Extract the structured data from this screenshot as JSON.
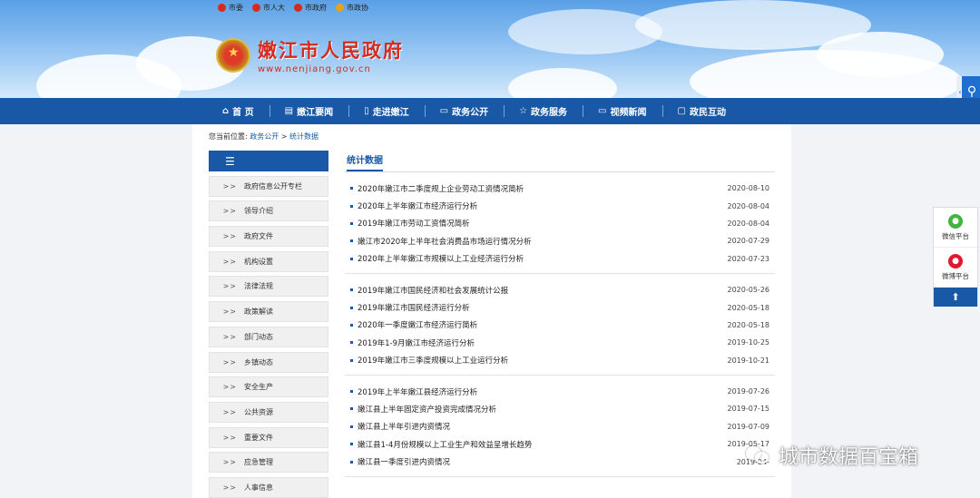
{
  "header": {
    "toplinks": [
      "市委",
      "市人大",
      "市政府",
      "市政协"
    ],
    "site_title": "嫩江市人民政府",
    "site_url": "www.nenjiang.gov.cn"
  },
  "nav": {
    "items": [
      {
        "label": "首 页",
        "icon": "home-icon"
      },
      {
        "label": "嫩江要闻",
        "icon": "book-icon"
      },
      {
        "label": "走进嫩江",
        "icon": "door-icon"
      },
      {
        "label": "政务公开",
        "icon": "monitor-icon"
      },
      {
        "label": "政务服务",
        "icon": "star-icon"
      },
      {
        "label": "视频新闻",
        "icon": "screen-icon"
      },
      {
        "label": "政民互动",
        "icon": "chat-icon"
      }
    ]
  },
  "breadcrumb": {
    "prefix": "您当前位置:",
    "level1": "政务公开",
    "sep": ">",
    "level2": "统计数据"
  },
  "sidebar": {
    "items": [
      "政府信息公开专栏",
      "领导介绍",
      "政府文件",
      "机构设置",
      "法律法规",
      "政策解读",
      "部门动态",
      "乡镇动态",
      "安全生产",
      "公共资源",
      "重要文件",
      "应急管理",
      "人事信息"
    ]
  },
  "main": {
    "tab_label": "统计数据",
    "groups": [
      [
        {
          "title": "2020年嫩江市二季度规上企业劳动工资情况简析",
          "date": "2020-08-10"
        },
        {
          "title": "2020年上半年嫩江市经济运行分析",
          "date": "2020-08-04"
        },
        {
          "title": "2019年嫩江市劳动工资情况简析",
          "date": "2020-08-04"
        },
        {
          "title": "嫩江市2020年上半年社会消费品市场运行情况分析",
          "date": "2020-07-29"
        },
        {
          "title": "2020年上半年嫩江市规模以上工业经济运行分析",
          "date": "2020-07-23"
        }
      ],
      [
        {
          "title": "2019年嫩江市国民经济和社会发展统计公报",
          "date": "2020-05-26"
        },
        {
          "title": "2019年嫩江市国民经济运行分析",
          "date": "2020-05-18"
        },
        {
          "title": "2020年一季度嫩江市经济运行简析",
          "date": "2020-05-18"
        },
        {
          "title": "2019年1-9月嫩江市经济运行分析",
          "date": "2019-10-25"
        },
        {
          "title": "2019年嫩江市三季度规模以上工业运行分析",
          "date": "2019-10-21"
        }
      ],
      [
        {
          "title": "2019年上半年嫩江县经济运行分析",
          "date": "2019-07-26"
        },
        {
          "title": "嫩江县上半年固定资产投资完成情况分析",
          "date": "2019-07-15"
        },
        {
          "title": "嫩江县上半年引进内资情况",
          "date": "2019-07-09"
        },
        {
          "title": "嫩江县1-4月份规模以上工业生产和效益呈增长趋势",
          "date": "2019-05-17"
        },
        {
          "title": "嫩江县一季度引进内资情况",
          "date": "2019-04-"
        }
      ]
    ]
  },
  "float_widget": {
    "wechat_label": "微信平台",
    "weibo_label": "微博平台"
  },
  "watermark": {
    "text": "城市数据百宝箱"
  }
}
